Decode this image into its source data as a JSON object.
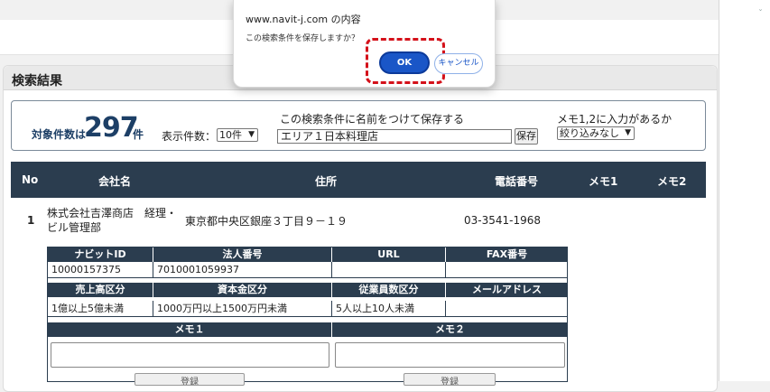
{
  "panel": {
    "title": "検索結果"
  },
  "summary": {
    "count_label": "対象件数は",
    "count": "297",
    "count_unit": "件",
    "per_page_label": "表示件数：",
    "per_page_value": "10件",
    "save_label": "この検索条件に名前をつけて保存する",
    "save_input_value": "エリア１日本料理店",
    "save_button": "保存",
    "memo_filter_label": "メモ1,2に入力があるか",
    "memo_filter_value": "絞り込みなし"
  },
  "table": {
    "headers": [
      "No",
      "会社名",
      "住所",
      "電話番号",
      "メモ1",
      "メモ2"
    ]
  },
  "row": {
    "no": "1",
    "company": "株式会社吉澤商店　経理・ビル管理部",
    "address": "東京都中央区銀座３丁目９－１９",
    "phone": "03-3541-1968"
  },
  "detail": {
    "headers1": [
      "ナビットID",
      "法人番号",
      "URL",
      "FAX番号"
    ],
    "values1": [
      "10000157375",
      "7010001059937",
      "",
      ""
    ],
    "headers2": [
      "売上高区分",
      "資本金区分",
      "従業員数区分",
      "メールアドレス"
    ],
    "values2": [
      "1億以上5億未満",
      "1000万円以上1500万円未満",
      "5人以上10人未満",
      ""
    ],
    "memo1_label": "メモ１",
    "memo2_label": "メモ２",
    "register_label": "登録"
  },
  "dialog": {
    "title": "www.navit-j.com の内容",
    "message": "この検索条件を保存しますか？",
    "ok": "OK",
    "cancel": "キャンセル"
  },
  "colors": {
    "header_bg": "#2b3d4f",
    "accent": "#1d3f66",
    "ok_button": "#1a56c7",
    "highlight": "#d4111a"
  }
}
